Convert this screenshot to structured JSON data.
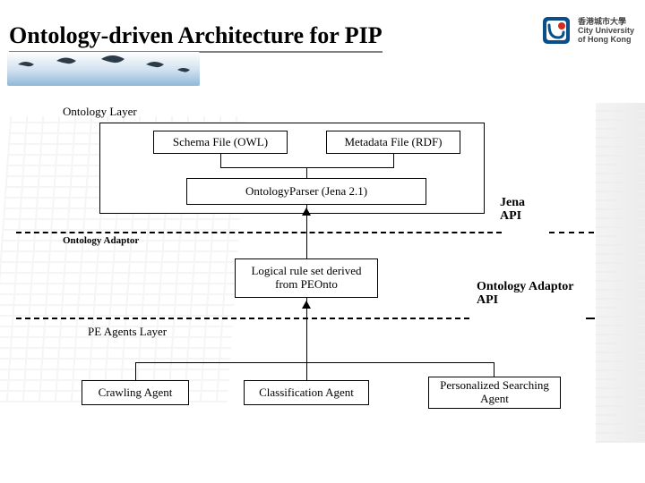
{
  "slide": {
    "title": "Ontology-driven Architecture for PIP",
    "university": {
      "cn_line": "香港城市大學",
      "en_line1": "City University",
      "en_line2": "of Hong Kong"
    }
  },
  "diagram": {
    "layers": {
      "ontology_layer": "Ontology Layer",
      "ontology_adaptor": "Ontology Adaptor",
      "pe_agents_layer": "PE Agents Layer"
    },
    "boxes": {
      "schema_file": "Schema File (OWL)",
      "metadata_file": "Metadata File (RDF)",
      "ontology_parser": "OntologyParser  (Jena 2.1)",
      "logical_rule_set": "Logical rule set  derived from PEOnto",
      "crawling_agent": "Crawling Agent",
      "classification_agent": "Classification Agent",
      "personalized_searching_agent": "Personalized Searching Agent"
    },
    "api_labels": {
      "jena_api_line1": "Jena",
      "jena_api_line2": "API",
      "ontology_adaptor_api_line1": "Ontology Adaptor",
      "ontology_adaptor_api_line2": "API"
    }
  }
}
